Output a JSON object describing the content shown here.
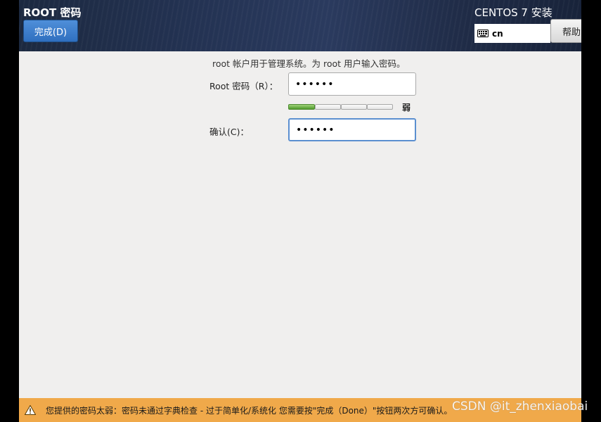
{
  "header": {
    "page_title": "ROOT 密码",
    "done_label": "完成(D)",
    "install_title": "CENTOS 7 安装",
    "keyboard_layout": "cn",
    "help_label": "帮助"
  },
  "form": {
    "instruction": "root 帐户用于管理系统。为 root 用户输入密码。",
    "root_password_label": "Root 密码（R）：",
    "root_password_value": "••••••",
    "strength_label": "弱",
    "strength_level": 0.25,
    "confirm_label": "确认(C)：",
    "confirm_value": "••••••"
  },
  "warning": {
    "text": "您提供的密码太弱：密码未通过字典检查 - 过于简单化/系统化 您需要按\"完成（Done）\"按钮两次方可确认。",
    "color": "#f0a94a"
  },
  "watermark": "CSDN @it_zhenxiaobai"
}
